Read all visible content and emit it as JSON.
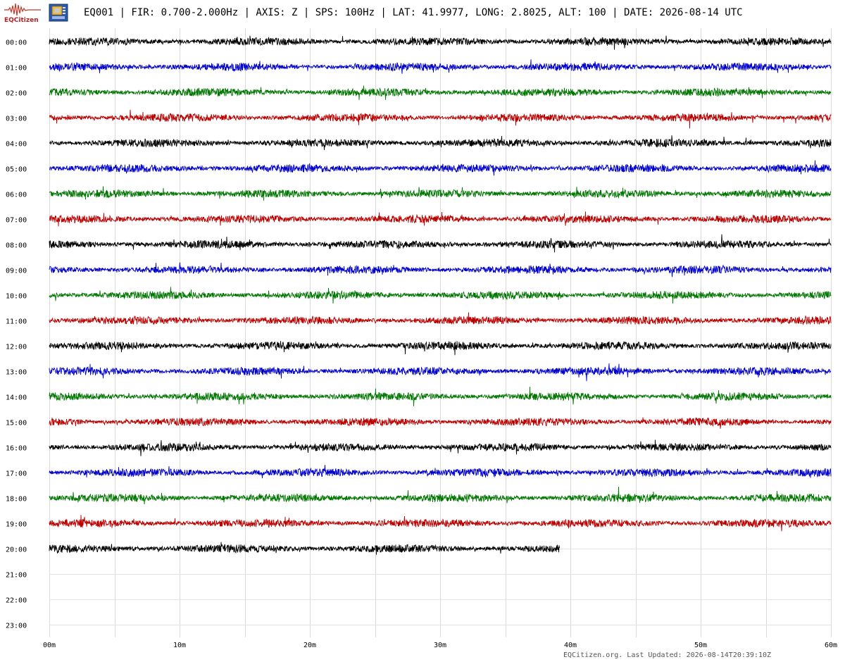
{
  "header": {
    "logo_text": "EQCitizen",
    "title": "EQ001 | FIR: 0.700-2.000Hz | AXIS: Z | SPS: 100Hz | LAT: 41.9977, LONG: 2.8025, ALT: 100 | DATE: 2026-08-14 UTC"
  },
  "footer": {
    "text": "EQCitizen.org. Last Updated: 2026-08-14T20:39:10Z"
  },
  "chart_data": {
    "type": "line",
    "title": "EQ001 | FIR: 0.700-2.000Hz | AXIS: Z | SPS: 100Hz | LAT: 41.9977, LONG: 2.8025, ALT: 100 | DATE: 2026-08-14 UTC",
    "xlabel": "",
    "ylabel": "",
    "xlim": [
      0,
      60
    ],
    "x_ticks": [
      {
        "value": 0,
        "label": "00m"
      },
      {
        "value": 10,
        "label": "10m"
      },
      {
        "value": 20,
        "label": "20m"
      },
      {
        "value": 30,
        "label": "30m"
      },
      {
        "value": 40,
        "label": "40m"
      },
      {
        "value": 50,
        "label": "50m"
      },
      {
        "value": 60,
        "label": "60m"
      }
    ],
    "x_minor_step": 5,
    "grid": true,
    "row_labels": [
      "00:00",
      "01:00",
      "02:00",
      "03:00",
      "04:00",
      "05:00",
      "06:00",
      "07:00",
      "08:00",
      "09:00",
      "10:00",
      "11:00",
      "12:00",
      "13:00",
      "14:00",
      "15:00",
      "16:00",
      "17:00",
      "18:00",
      "19:00",
      "20:00",
      "21:00",
      "22:00",
      "23:00"
    ],
    "row_colors": [
      "#000000",
      "#0000cc",
      "#007700",
      "#bb0000"
    ],
    "series": [
      {
        "hour": "00:00",
        "end_minute": 60
      },
      {
        "hour": "01:00",
        "end_minute": 60
      },
      {
        "hour": "02:00",
        "end_minute": 60
      },
      {
        "hour": "03:00",
        "end_minute": 60
      },
      {
        "hour": "04:00",
        "end_minute": 60
      },
      {
        "hour": "05:00",
        "end_minute": 60
      },
      {
        "hour": "06:00",
        "end_minute": 60
      },
      {
        "hour": "07:00",
        "end_minute": 60
      },
      {
        "hour": "08:00",
        "end_minute": 60
      },
      {
        "hour": "09:00",
        "end_minute": 60
      },
      {
        "hour": "10:00",
        "end_minute": 60
      },
      {
        "hour": "11:00",
        "end_minute": 60
      },
      {
        "hour": "12:00",
        "end_minute": 60
      },
      {
        "hour": "13:00",
        "end_minute": 60
      },
      {
        "hour": "14:00",
        "end_minute": 60
      },
      {
        "hour": "15:00",
        "end_minute": 60
      },
      {
        "hour": "16:00",
        "end_minute": 60
      },
      {
        "hour": "17:00",
        "end_minute": 60
      },
      {
        "hour": "18:00",
        "end_minute": 60
      },
      {
        "hour": "19:00",
        "end_minute": 60
      },
      {
        "hour": "20:00",
        "end_minute": 39.17
      }
    ]
  }
}
